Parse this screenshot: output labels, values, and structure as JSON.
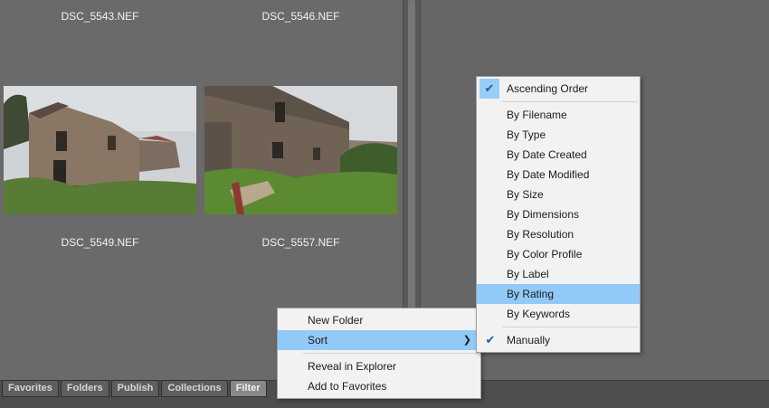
{
  "thumbnails": [
    {
      "filename": "DSC_5543.NEF"
    },
    {
      "filename": "DSC_5546.NEF"
    },
    {
      "filename": "DSC_5549.NEF"
    },
    {
      "filename": "DSC_5557.NEF"
    }
  ],
  "panel_tabs": [
    "Favorites",
    "Folders",
    "Publish",
    "Collections",
    "Filter"
  ],
  "active_tab": "Filter",
  "context_menu": {
    "items": [
      "New Folder",
      "Sort",
      "Reveal in Explorer",
      "Add to Favorites"
    ],
    "highlighted": "Sort"
  },
  "sort_submenu": {
    "order": "Ascending Order",
    "items": [
      "By Filename",
      "By Type",
      "By Date Created",
      "By Date Modified",
      "By Size",
      "By Dimensions",
      "By Resolution",
      "By Color Profile",
      "By Label",
      "By Rating",
      "By Keywords"
    ],
    "highlighted": "By Rating",
    "manual": "Manually",
    "checked": [
      "Ascending Order",
      "Manually"
    ]
  },
  "colors": {
    "highlight": "#91c9f7",
    "check": "#1a5fa8"
  }
}
